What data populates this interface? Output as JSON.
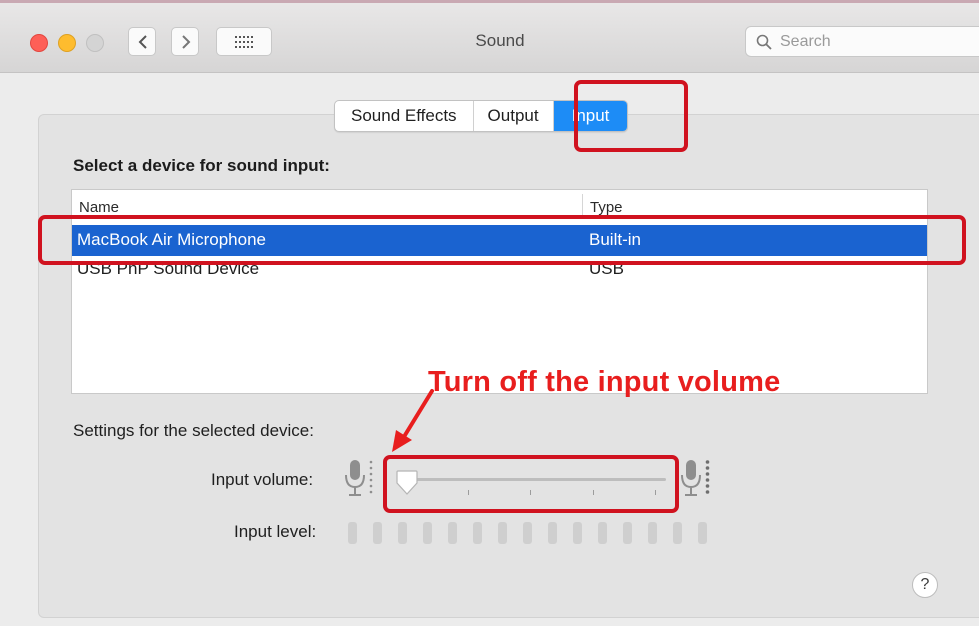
{
  "window": {
    "title": "Sound",
    "search_placeholder": "Search",
    "traffic_lights": [
      "#fe5f57",
      "#febc2e",
      "#d4d4d4"
    ]
  },
  "tabs": [
    {
      "label": "Sound Effects",
      "active": false
    },
    {
      "label": "Output",
      "active": false
    },
    {
      "label": "Input",
      "active": true
    }
  ],
  "device_section": {
    "heading": "Select a device for sound input:",
    "columns": [
      "Name",
      "Type"
    ],
    "rows": [
      {
        "name": "MacBook Air Microphone",
        "type": "Built-in",
        "selected": true
      },
      {
        "name": "USB PnP Sound Device",
        "type": "USB",
        "selected": false
      }
    ]
  },
  "settings": {
    "label": "Settings for the selected device:",
    "input_volume_label": "Input volume:",
    "input_volume_value": 0,
    "input_level_label": "Input level:",
    "input_level_bars": 15,
    "input_level_value": 0
  },
  "annotation": {
    "text": "Turn off the input volume",
    "color": "#e81e1e"
  },
  "help_label": "?",
  "colors": {
    "selection": "#1a63d0",
    "active_tab": "#1d8cf6",
    "highlight_box": "#d0121f"
  }
}
